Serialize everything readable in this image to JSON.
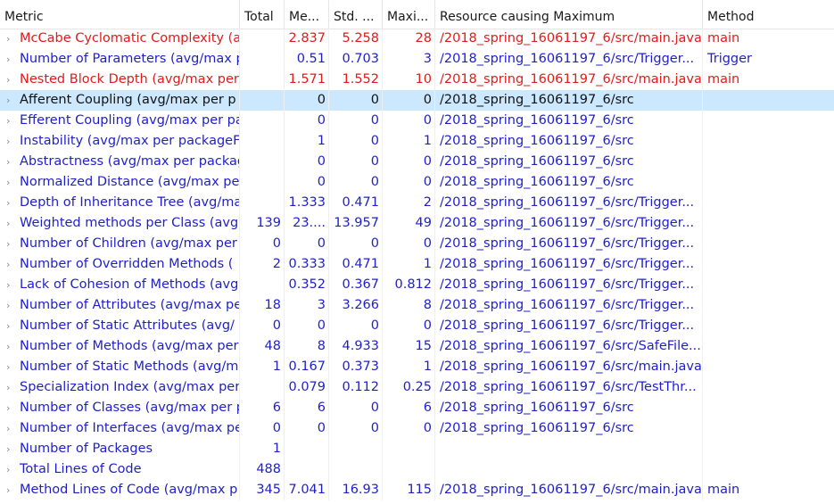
{
  "colors": {
    "normal": "#1f1fc8",
    "violation": "#e01b1b",
    "selected_text": "#111111",
    "selected_bg": "#cce8ff"
  },
  "expander_glyph": "›",
  "columns": [
    {
      "key": "metric",
      "label": "Metric"
    },
    {
      "key": "total",
      "label": "Total"
    },
    {
      "key": "mean",
      "label": "Me..."
    },
    {
      "key": "std",
      "label": "Std. ..."
    },
    {
      "key": "max",
      "label": "Maxi..."
    },
    {
      "key": "resource",
      "label": "Resource causing Maximum"
    },
    {
      "key": "method",
      "label": "Method"
    }
  ],
  "rows": [
    {
      "metric": "McCabe Cyclomatic Complexity (a",
      "total": "",
      "mean": "2.837",
      "std": "5.258",
      "max": "28",
      "resource": "/2018_spring_16061197_6/src/main.java",
      "method": "main",
      "status": "violation"
    },
    {
      "metric": "Number of Parameters (avg/max p",
      "total": "",
      "mean": "0.51",
      "std": "0.703",
      "max": "3",
      "resource": "/2018_spring_16061197_6/src/Trigger...",
      "method": "Trigger",
      "status": "normal"
    },
    {
      "metric": "Nested Block Depth (avg/max per",
      "total": "",
      "mean": "1.571",
      "std": "1.552",
      "max": "10",
      "resource": "/2018_spring_16061197_6/src/main.java",
      "method": "main",
      "status": "violation"
    },
    {
      "metric": "Afferent Coupling (avg/max per p",
      "total": "",
      "mean": "0",
      "std": "0",
      "max": "0",
      "resource": "/2018_spring_16061197_6/src",
      "method": "",
      "status": "selected"
    },
    {
      "metric": "Efferent Coupling (avg/max per pa",
      "total": "",
      "mean": "0",
      "std": "0",
      "max": "0",
      "resource": "/2018_spring_16061197_6/src",
      "method": "",
      "status": "normal"
    },
    {
      "metric": "Instability (avg/max per packageFr",
      "total": "",
      "mean": "1",
      "std": "0",
      "max": "1",
      "resource": "/2018_spring_16061197_6/src",
      "method": "",
      "status": "normal"
    },
    {
      "metric": "Abstractness (avg/max per packag",
      "total": "",
      "mean": "0",
      "std": "0",
      "max": "0",
      "resource": "/2018_spring_16061197_6/src",
      "method": "",
      "status": "normal"
    },
    {
      "metric": "Normalized Distance (avg/max pe",
      "total": "",
      "mean": "0",
      "std": "0",
      "max": "0",
      "resource": "/2018_spring_16061197_6/src",
      "method": "",
      "status": "normal"
    },
    {
      "metric": "Depth of Inheritance Tree (avg/ma",
      "total": "",
      "mean": "1.333",
      "std": "0.471",
      "max": "2",
      "resource": "/2018_spring_16061197_6/src/Trigger...",
      "method": "",
      "status": "normal"
    },
    {
      "metric": "Weighted methods per Class (avg",
      "total": "139",
      "mean": "23....",
      "std": "13.957",
      "max": "49",
      "resource": "/2018_spring_16061197_6/src/Trigger...",
      "method": "",
      "status": "normal"
    },
    {
      "metric": "Number of Children (avg/max per",
      "total": "0",
      "mean": "0",
      "std": "0",
      "max": "0",
      "resource": "/2018_spring_16061197_6/src/Trigger...",
      "method": "",
      "status": "normal"
    },
    {
      "metric": "Number of Overridden Methods (",
      "total": "2",
      "mean": "0.333",
      "std": "0.471",
      "max": "1",
      "resource": "/2018_spring_16061197_6/src/Trigger...",
      "method": "",
      "status": "normal"
    },
    {
      "metric": "Lack of Cohesion of Methods (avg",
      "total": "",
      "mean": "0.352",
      "std": "0.367",
      "max": "0.812",
      "resource": "/2018_spring_16061197_6/src/Trigger...",
      "method": "",
      "status": "normal"
    },
    {
      "metric": "Number of Attributes (avg/max pe",
      "total": "18",
      "mean": "3",
      "std": "3.266",
      "max": "8",
      "resource": "/2018_spring_16061197_6/src/Trigger...",
      "method": "",
      "status": "normal"
    },
    {
      "metric": "Number of Static Attributes (avg/",
      "total": "0",
      "mean": "0",
      "std": "0",
      "max": "0",
      "resource": "/2018_spring_16061197_6/src/Trigger...",
      "method": "",
      "status": "normal"
    },
    {
      "metric": "Number of Methods (avg/max per",
      "total": "48",
      "mean": "8",
      "std": "4.933",
      "max": "15",
      "resource": "/2018_spring_16061197_6/src/SafeFile...",
      "method": "",
      "status": "normal"
    },
    {
      "metric": "Number of Static Methods (avg/m",
      "total": "1",
      "mean": "0.167",
      "std": "0.373",
      "max": "1",
      "resource": "/2018_spring_16061197_6/src/main.java",
      "method": "",
      "status": "normal"
    },
    {
      "metric": "Specialization Index (avg/max per",
      "total": "",
      "mean": "0.079",
      "std": "0.112",
      "max": "0.25",
      "resource": "/2018_spring_16061197_6/src/TestThr...",
      "method": "",
      "status": "normal"
    },
    {
      "metric": "Number of Classes (avg/max per p",
      "total": "6",
      "mean": "6",
      "std": "0",
      "max": "6",
      "resource": "/2018_spring_16061197_6/src",
      "method": "",
      "status": "normal"
    },
    {
      "metric": "Number of Interfaces (avg/max pe",
      "total": "0",
      "mean": "0",
      "std": "0",
      "max": "0",
      "resource": "/2018_spring_16061197_6/src",
      "method": "",
      "status": "normal"
    },
    {
      "metric": "Number of Packages",
      "total": "1",
      "mean": "",
      "std": "",
      "max": "",
      "resource": "",
      "method": "",
      "status": "normal"
    },
    {
      "metric": "Total Lines of Code",
      "total": "488",
      "mean": "",
      "std": "",
      "max": "",
      "resource": "",
      "method": "",
      "status": "normal"
    },
    {
      "metric": "Method Lines of Code (avg/max p",
      "total": "345",
      "mean": "7.041",
      "std": "16.93",
      "max": "115",
      "resource": "/2018_spring_16061197_6/src/main.java",
      "method": "main",
      "status": "normal"
    }
  ]
}
